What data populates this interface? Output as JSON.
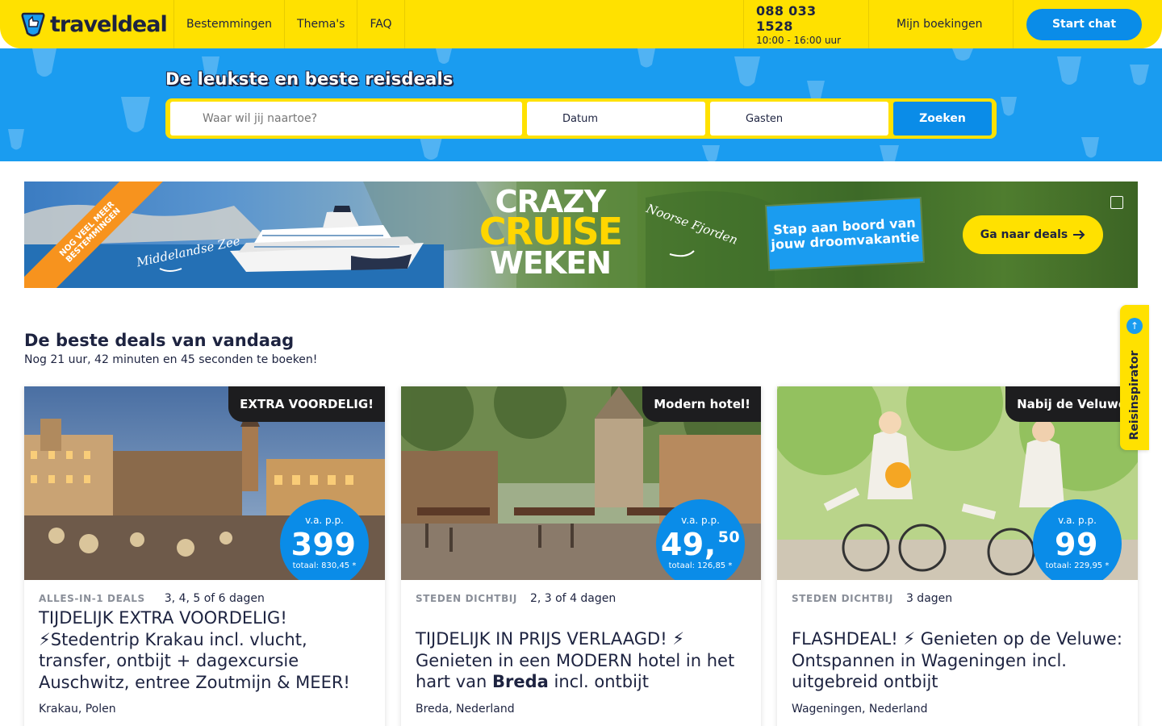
{
  "header": {
    "brand": "traveldeal",
    "nav": [
      "Bestemmingen",
      "Thema's",
      "FAQ"
    ],
    "phone": "088 033 1528",
    "hours": "10:00 - 16:00 uur",
    "bookings_icon": "",
    "bookings_label": "Mijn boekingen",
    "chat_label": "Start chat"
  },
  "hero": {
    "title": "De leukste en beste reisdeals",
    "search": {
      "where_icon": "",
      "where_placeholder": "Waar wil jij naartoe?",
      "date_icon": "",
      "date_label": "Datum",
      "date_chevron": "",
      "guests_icon": "",
      "guests_label": "Gasten",
      "guests_chevron": "",
      "button": "Zoeken"
    }
  },
  "banner": {
    "ribbon": "NOG VEEL MEER BESTEMMINGEN",
    "left_label": "Middelandse Zee",
    "headline": [
      "CRAZY",
      "CRUISE",
      "WEKEN"
    ],
    "right_label": "Noorse Fjorden",
    "board_text": "Stap aan boord van jouw droomvakantie",
    "cta": "Ga naar deals",
    "cta_icon": "arrow-right-icon",
    "close_icon": ""
  },
  "section": {
    "title": "De beste deals van vandaag",
    "subtitle": "Nog 21 uur, 42 minuten en 45 seconden te boeken!"
  },
  "cards": [
    {
      "tag": "EXTRA VOORDELIG!",
      "badge_icon": "",
      "price_label": "v.a. p.p.",
      "price": "399",
      "price_cents": "",
      "total": "totaal: 830,45 *",
      "category": "ALLES-IN-1 DEALS",
      "icons": [
        "",
        ""
      ],
      "duration": "3, 4, 5 of 6 dagen",
      "title_plain": "TIJDELIJK EXTRA VOORDELIG! ⚡Stedentrip Krakau incl. vlucht, transfer, ontbijt + dagexcursie Auschwitz, entree Zoutmijn & MEER!",
      "location": "Krakau, Polen"
    },
    {
      "tag": "Modern hotel!",
      "badge_icon": "",
      "price_label": "v.a. p.p.",
      "price": "49,",
      "price_cents": "50",
      "total": "totaal: 126,85 *",
      "category": "STEDEN DICHTBIJ",
      "icons": [
        ""
      ],
      "duration": "2, 3 of 4 dagen",
      "title_pre": "TIJDELIJK IN PRIJS VERLAAGD! ⚡ Genieten in een MODERN hotel in het hart van ",
      "title_bold": "Breda",
      "title_post": " incl. ontbijt",
      "location": "Breda, Nederland"
    },
    {
      "tag": "Nabij de Veluwe",
      "badge_icon": "",
      "price_label": "v.a. p.p.",
      "price": "99",
      "price_cents": "",
      "total": "totaal: 229,95 *",
      "category": "STEDEN DICHTBIJ",
      "icons": [
        ""
      ],
      "duration": "3 dagen",
      "title_plain": "FLASHDEAL! ⚡ Genieten op de Veluwe: Ontspannen in Wageningen incl. uitgebreid ontbijt",
      "location": "Wageningen, Nederland"
    }
  ],
  "side_tab": {
    "label": "Reisinspirator",
    "icon": "↑"
  },
  "colors": {
    "brand_yellow": "#ffe100",
    "brand_blue": "#1a9cf0",
    "button_blue": "#0a8ce8",
    "navy": "#1d2340"
  }
}
